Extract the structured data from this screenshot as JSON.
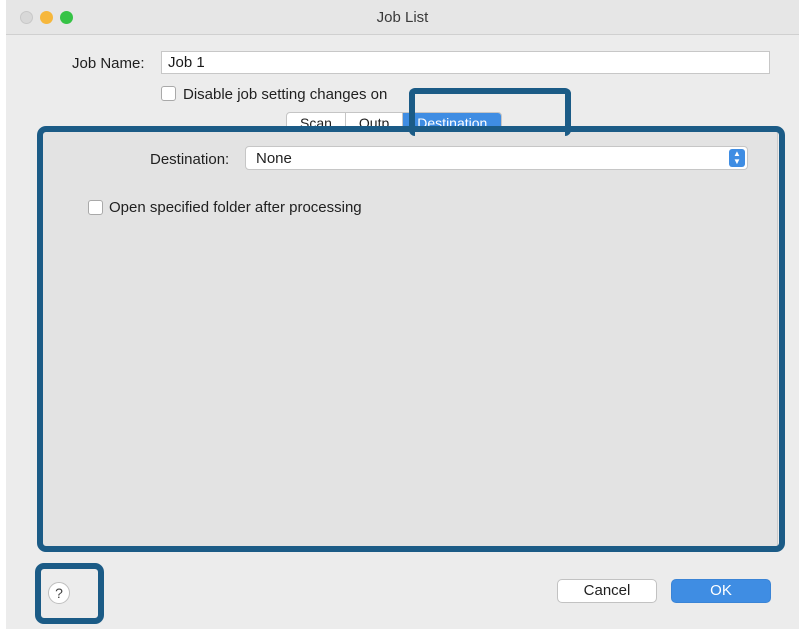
{
  "window": {
    "title": "Job List"
  },
  "form": {
    "job_name_label": "Job Name:",
    "job_name_value": "Job 1",
    "disable_checkbox_label": "Disable job setting changes on"
  },
  "tabs": [
    {
      "label": "Scan",
      "active": false
    },
    {
      "label": "Outp",
      "active": false
    },
    {
      "label": "Destination",
      "active": true
    }
  ],
  "destination": {
    "label": "Destination:",
    "selected": "None",
    "open_folder_label": "Open specified folder after processing"
  },
  "footer": {
    "help_label": "?",
    "cancel_label": "Cancel",
    "ok_label": "OK"
  },
  "colors": {
    "accent": "#3f8de3",
    "annotation": "#1b5b86"
  }
}
